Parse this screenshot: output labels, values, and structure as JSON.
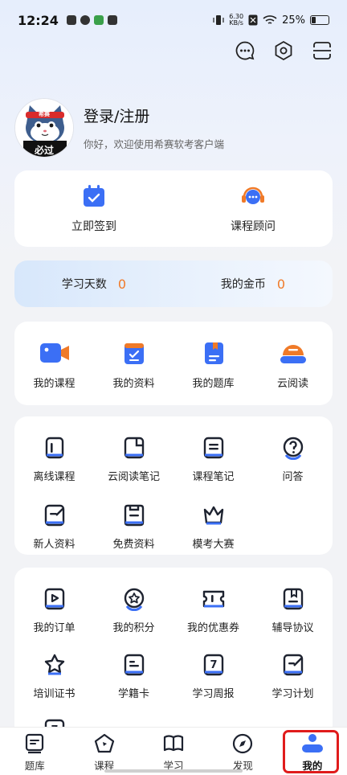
{
  "status_bar": {
    "time": "12:24",
    "net_speed_value": "6.30",
    "net_speed_unit": "KB/s",
    "battery": "25%"
  },
  "profile": {
    "title": "登录/注册",
    "subtitle": "你好，欢迎使用希赛软考客户端",
    "avatar_badge": "必过",
    "avatar_band": "希赛"
  },
  "quick_actions": [
    {
      "label": "立即签到",
      "icon": "calendar-check-icon"
    },
    {
      "label": "课程顾问",
      "icon": "headset-chat-icon"
    }
  ],
  "stats": [
    {
      "label": "学习天数",
      "value": "0"
    },
    {
      "label": "我的金币",
      "value": "0"
    }
  ],
  "main_features": [
    {
      "label": "我的课程",
      "icon": "video-camera-icon"
    },
    {
      "label": "我的资料",
      "icon": "document-check-icon"
    },
    {
      "label": "我的题库",
      "icon": "question-bank-icon"
    },
    {
      "label": "云阅读",
      "icon": "cloud-read-icon"
    }
  ],
  "tools": [
    {
      "label": "离线课程",
      "icon": "offline-course-icon"
    },
    {
      "label": "云阅读笔记",
      "icon": "reading-note-icon"
    },
    {
      "label": "课程笔记",
      "icon": "course-note-icon"
    },
    {
      "label": "问答",
      "icon": "question-icon"
    },
    {
      "label": "新人资料",
      "icon": "newbie-material-icon"
    },
    {
      "label": "免费资料",
      "icon": "free-material-icon"
    },
    {
      "label": "模考大赛",
      "icon": "crown-icon"
    }
  ],
  "orders": [
    {
      "label": "我的订单",
      "icon": "order-icon"
    },
    {
      "label": "我的积分",
      "icon": "points-icon"
    },
    {
      "label": "我的优惠券",
      "icon": "coupon-icon"
    },
    {
      "label": "辅导协议",
      "icon": "agreement-icon"
    },
    {
      "label": "培训证书",
      "icon": "certificate-icon"
    },
    {
      "label": "学籍卡",
      "icon": "student-card-icon"
    },
    {
      "label": "学习周报",
      "icon": "weekly-report-icon"
    },
    {
      "label": "学习计划",
      "icon": "study-plan-icon"
    },
    {
      "label": "",
      "icon": "calendar-icon"
    }
  ],
  "calendar_glyph": "7",
  "bottom_nav": [
    {
      "label": "题库",
      "icon": "question-bank-nav-icon",
      "active": false
    },
    {
      "label": "课程",
      "icon": "course-nav-icon",
      "active": false
    },
    {
      "label": "学习",
      "icon": "study-nav-icon",
      "active": false
    },
    {
      "label": "发现",
      "icon": "compass-icon",
      "active": false
    },
    {
      "label": "我的",
      "icon": "profile-nav-icon",
      "active": true
    }
  ],
  "colors": {
    "accent": "#3b6ff5",
    "stat_value": "#f07a28",
    "highlight": "#e01c1c"
  }
}
